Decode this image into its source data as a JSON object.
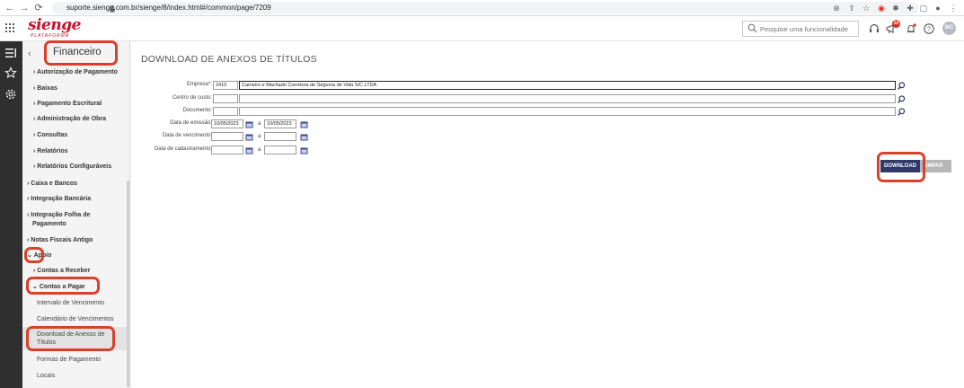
{
  "browser": {
    "url": "suporte.sienge.com.br/sienge/8/index.html#/common/page/7209"
  },
  "header": {
    "logo": "sienge",
    "logo_sub": "PLATAFORMA",
    "search_placeholder": "Pesquise uma funcionalidade",
    "notification_count": "10",
    "avatar_initials": "WC"
  },
  "sidebar": {
    "title": "Financeiro",
    "items": [
      {
        "label": "Autorização de Pagamento"
      },
      {
        "label": "Baixas"
      },
      {
        "label": "Pagamento Escritural"
      },
      {
        "label": "Administração de Obra"
      },
      {
        "label": "Consultas"
      },
      {
        "label": "Relatórios"
      },
      {
        "label": "Relatórios Configuráveis"
      },
      {
        "label": "Caixa e Bancos"
      },
      {
        "label": "Integração Bancária"
      },
      {
        "label": "Integração Folha de"
      },
      {
        "label": "Pagamento"
      },
      {
        "label": "Notas Fiscais Antigo"
      },
      {
        "label": "Apoio"
      },
      {
        "label": "Contas a Receber"
      },
      {
        "label": "Contas a Pagar"
      },
      {
        "label": "Intervalo de Vencimento"
      },
      {
        "label": "Calendário de Vencimentos"
      },
      {
        "label": "Download de Anexos de"
      },
      {
        "label": "Títulos"
      },
      {
        "label": "Formas de Pagamento"
      },
      {
        "label": "Locais"
      }
    ]
  },
  "main": {
    "title": "DOWNLOAD DE ANEXOS DE TÍTULOS",
    "form": {
      "empresa_label": "Empresa*:",
      "empresa_code": "2410",
      "empresa_name": "Carneiro e Machado Corretora de Seguros de Vida S/C LTDA",
      "centro_label": "Centro de custo:",
      "documento_label": "Documento:",
      "emissao_label": "Data de emissão:",
      "emissao_de": "10/05/2023",
      "emissao_ate": "10/05/2023",
      "vencimento_label": "Data de vencimento:",
      "cadastramento_label": "Data de cadastramento:",
      "range_sep": "a"
    },
    "buttons": {
      "download": "DOWNLOAD",
      "limpar": "LIMPAR"
    }
  }
}
